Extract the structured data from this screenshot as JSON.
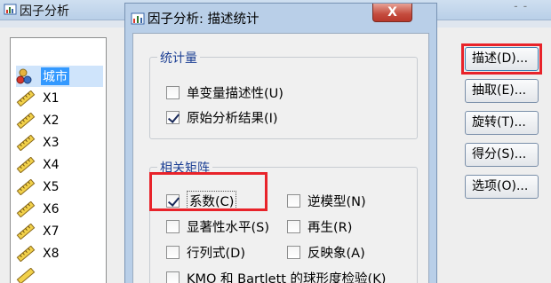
{
  "main_window": {
    "title": "因子分析",
    "right_edge_text": "ᐨ ᐨ",
    "variables": [
      {
        "label": "城市",
        "type": "nominal",
        "selected": true
      },
      {
        "label": "X1",
        "type": "scale",
        "selected": false
      },
      {
        "label": "X2",
        "type": "scale",
        "selected": false
      },
      {
        "label": "X3",
        "type": "scale",
        "selected": false
      },
      {
        "label": "X4",
        "type": "scale",
        "selected": false
      },
      {
        "label": "X5",
        "type": "scale",
        "selected": false
      },
      {
        "label": "X6",
        "type": "scale",
        "selected": false
      },
      {
        "label": "X7",
        "type": "scale",
        "selected": false
      },
      {
        "label": "X8",
        "type": "scale",
        "selected": false
      }
    ],
    "buttons": [
      {
        "label": "描述(D)..."
      },
      {
        "label": "抽取(E)..."
      },
      {
        "label": "旋转(T)..."
      },
      {
        "label": "得分(S)..."
      },
      {
        "label": "选项(O)..."
      }
    ]
  },
  "dialog": {
    "title": "因子分析: 描述统计",
    "close_glyph": "X",
    "statistics_group": {
      "label": "统计量",
      "items": [
        {
          "label": "单变量描述性(U)",
          "checked": false
        },
        {
          "label": "原始分析结果(I)",
          "checked": true
        }
      ]
    },
    "correlation_group": {
      "label": "相关矩阵",
      "left_items": [
        {
          "label": "系数(C)",
          "checked": true
        },
        {
          "label": "显著性水平(S)",
          "checked": false
        },
        {
          "label": "行列式(D)",
          "checked": false
        },
        {
          "label": "KMO 和 Bartlett 的球形度检验(K)",
          "checked": false
        }
      ],
      "right_items": [
        {
          "label": "逆模型(N)",
          "checked": false
        },
        {
          "label": "再生(R)",
          "checked": false
        },
        {
          "label": "反映象(A)",
          "checked": false
        }
      ]
    }
  },
  "colors": {
    "highlight_red": "#e8232a",
    "group_label_blue": "#1c3f94",
    "selection_blue": "#3399ff",
    "close_button_red": "#c44b3d"
  }
}
